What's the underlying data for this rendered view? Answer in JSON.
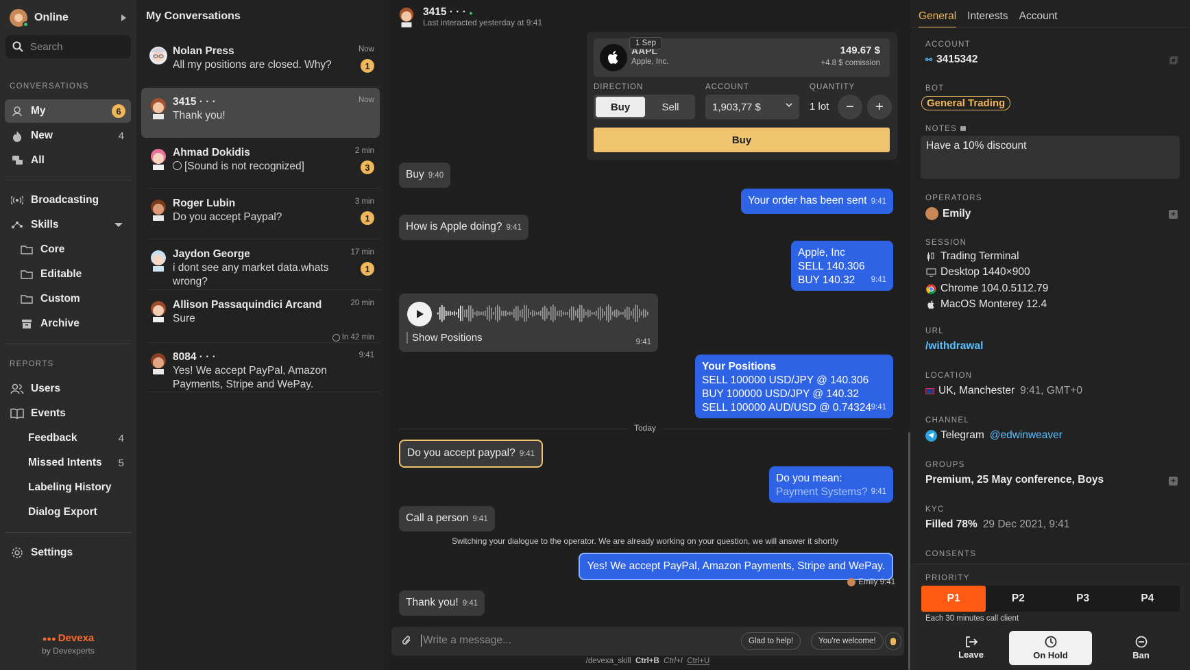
{
  "nav": {
    "status": "Online",
    "search_placeholder": "Search",
    "conversations_title": "CONVERSATIONS",
    "items": [
      {
        "label": "My",
        "count": "6"
      },
      {
        "label": "New",
        "count": "4"
      },
      {
        "label": "All",
        "count": ""
      },
      {
        "label": "Broadcasting",
        "count": ""
      },
      {
        "label": "Skills",
        "count": ""
      },
      {
        "label": "Core",
        "count": ""
      },
      {
        "label": "Editable",
        "count": ""
      },
      {
        "label": "Custom",
        "count": ""
      },
      {
        "label": "Archive",
        "count": ""
      }
    ],
    "reports_title": "REPORTS",
    "reports": [
      {
        "label": "Users",
        "count": ""
      },
      {
        "label": "Events",
        "count": ""
      },
      {
        "label": "Feedback",
        "count": "4"
      },
      {
        "label": "Missed Intents",
        "count": "5"
      },
      {
        "label": "Labeling History",
        "count": ""
      },
      {
        "label": "Dialog Export",
        "count": ""
      }
    ],
    "settings": "Settings",
    "brand": "Devexa",
    "brand_by": "by Devexperts"
  },
  "conversations": {
    "title": "My Conversations",
    "list": [
      {
        "name": "Nolan Press",
        "message": "All my positions are closed. Why?",
        "time": "Now",
        "badge": "1"
      },
      {
        "name": "3415 · · ·",
        "message": "Thank you!",
        "time": "Now",
        "badge": ""
      },
      {
        "name": "Ahmad Dokidis",
        "message": "[Sound is not recognized]",
        "time": "2 min",
        "badge": "3"
      },
      {
        "name": "Roger Lubin",
        "message": "Do you accept Paypal?",
        "time": "3 min",
        "badge": "1"
      },
      {
        "name": "Jaydon George",
        "message": "i dont see any market data.whats wrong?",
        "time": "17 min",
        "badge": "1"
      },
      {
        "name": "Allison Passaquindici Arcand",
        "message": "Sure",
        "time": "20 min",
        "badge": "",
        "note": "In 42 min"
      },
      {
        "name": "8084 · · ·",
        "message": "Yes! We accept PayPal, Amazon Payments, Stripe and WePay.",
        "time": "9:41",
        "badge": ""
      }
    ]
  },
  "chat": {
    "name": "3415 · · ·",
    "subtitle": "Last interacted yesterday at 9:41",
    "order": {
      "date_tip": "1 Sep",
      "ticker": "AAPL",
      "company": "Apple, Inc.",
      "price": "149.67 $",
      "commission": "+4.8 $ comission",
      "direction_label": "DIRECTION",
      "buy": "Buy",
      "sell": "Sell",
      "account_label": "ACCOUNT",
      "account_value": "1,903,77 $",
      "quantity_label": "QUANTITY",
      "quantity": "1 lot",
      "minus": "−",
      "plus": "+",
      "submit": "Buy"
    },
    "messages": [
      {
        "text": "Buy",
        "time": "9:40"
      },
      {
        "text": "Your order has been sent",
        "time": "9:41"
      },
      {
        "text": "How is Apple doing?",
        "time": "9:41"
      },
      {
        "lines": [
          "Apple, Inc",
          "SELL 140.306",
          "BUY 140.32"
        ],
        "time": "9:41"
      },
      {
        "voice_caption": "Show Positions",
        "time": "9:41"
      },
      {
        "title": "Your Positions",
        "lines": [
          "SELL 100000 USD/JPY @ 140.306",
          "BUY 100000 USD/JPY @ 140.32",
          "SELL 100000 AUD/USD @ 0.74324"
        ],
        "time": "9:41"
      },
      {
        "text": "Do you accept paypal?",
        "time": "9:41"
      },
      {
        "text": "Do you mean:",
        "link": "Payment Systems?",
        "time": "9:41"
      },
      {
        "text": "Call a person",
        "time": "9:41"
      },
      {
        "text": "Yes! We accept PayPal, Amazon Payments, Stripe and WePay."
      },
      {
        "text": "Thank you!",
        "time": "9:41"
      }
    ],
    "divider": "Today",
    "system": "Switching your dialogue to the operator. We are already working on your question, we will answer it shortly",
    "signed_by": "Emily 9:41",
    "composer_placeholder": "Write a message...",
    "quick_replies": [
      "Glad to help!",
      "You're welcome!"
    ],
    "shortcuts": {
      "skill": "/devexa_skill",
      "bold": "Ctrl+B",
      "italic": "Ctrl+I",
      "underline": "Ctrl+U"
    }
  },
  "info": {
    "tabs": [
      "General",
      "Interests",
      "Account"
    ],
    "account_label": "ACCOUNT",
    "account": "3415342",
    "bot_label": "BOT",
    "bot": "General Trading",
    "notes_label": "NOTES",
    "notes": "Have a 10% discount",
    "operators_label": "OPERATORS",
    "operator": "Emily",
    "session_label": "SESSION",
    "session": [
      "Trading Terminal",
      "Desktop 1440×900",
      "Chrome 104.0.5112.79",
      "MacOS Monterey 12.4"
    ],
    "url_label": "URL",
    "url": "/withdrawal",
    "location_label": "LOCATION",
    "location": "UK, Manchester",
    "location_time": "9:41, GMT+0",
    "channel_label": "CHANNEL",
    "channel": "Telegram",
    "channel_handle": "@edwinweaver",
    "groups_label": "GROUPS",
    "groups": "Premium, 25 May conference, Boys",
    "kyc_label": "KYC",
    "kyc": "Filled 78%",
    "kyc_date": "29 Dec 2021, 9:41",
    "consents_label": "CONSENTS",
    "priority_label": "PRIORITY",
    "priorities": [
      "P1",
      "P2",
      "P3",
      "P4"
    ],
    "priority_note": "Each 30 minutes call client",
    "actions": [
      "Leave",
      "On Hold",
      "Ban"
    ]
  }
}
